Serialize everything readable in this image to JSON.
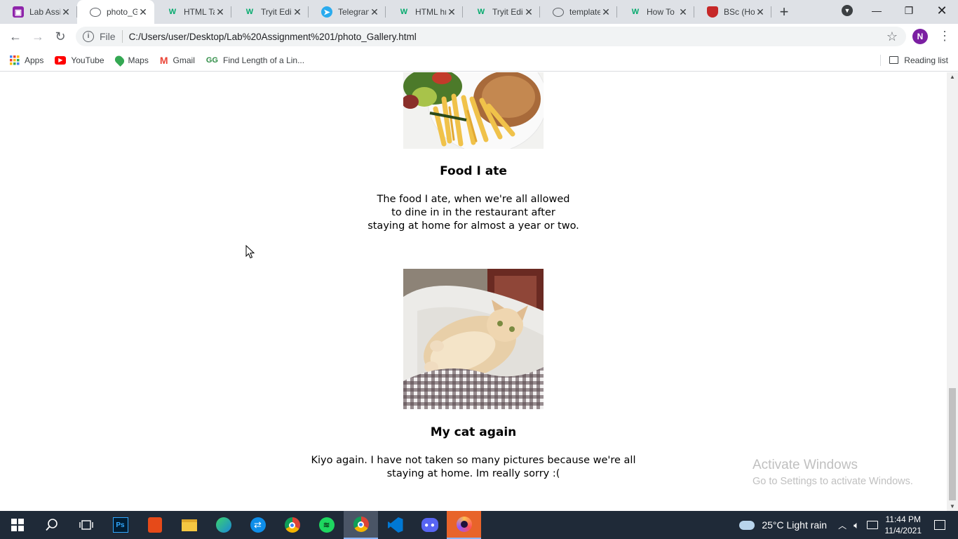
{
  "browser": {
    "tabs": [
      {
        "title": "Lab Assi",
        "icon": "purple-square-icon",
        "active": false
      },
      {
        "title": "photo_G",
        "icon": "globe-icon",
        "active": true
      },
      {
        "title": "HTML Ta",
        "icon": "w3schools-icon",
        "active": false
      },
      {
        "title": "Tryit Edi",
        "icon": "w3schools-icon",
        "active": false
      },
      {
        "title": "Telegran",
        "icon": "telegram-icon",
        "active": false
      },
      {
        "title": "HTML hr",
        "icon": "w3schools-icon",
        "active": false
      },
      {
        "title": "Tryit Edi",
        "icon": "w3schools-icon",
        "active": false
      },
      {
        "title": "template",
        "icon": "globe-icon",
        "active": false
      },
      {
        "title": "How To",
        "icon": "w3schools-icon",
        "active": false
      },
      {
        "title": "BSc (Hon",
        "icon": "crest-icon",
        "active": false
      }
    ],
    "new_tab_label": "+",
    "address": {
      "scheme_label": "File",
      "url": "C:/Users/user/Desktop/Lab%20Assignment%201/photo_Gallery.html"
    },
    "profile_initial": "N",
    "bookmarks": [
      {
        "label": "Apps",
        "icon": "apps-grid-icon"
      },
      {
        "label": "YouTube",
        "icon": "youtube-icon"
      },
      {
        "label": "Maps",
        "icon": "maps-pin-icon"
      },
      {
        "label": "Gmail",
        "icon": "gmail-icon"
      },
      {
        "label": "Find Length of a Lin...",
        "icon": "geeks-icon"
      }
    ],
    "reading_list": "Reading list"
  },
  "page": {
    "gallery": [
      {
        "title": "Food I ate",
        "lines": [
          "The food I ate, when we're all allowed",
          "to dine in in the restaurant after",
          "staying at home for almost a year or two."
        ]
      },
      {
        "title": "My cat again",
        "lines": [
          "Kiyo again. I have not taken so many pictures because we're all",
          "staying at home. Im really sorry :("
        ]
      }
    ]
  },
  "watermark": {
    "line1": "Activate Windows",
    "line2": "Go to Settings to activate Windows."
  },
  "taskbar": {
    "weather": "25°C  Light rain",
    "time": "11:44 PM",
    "date": "11/4/2021"
  },
  "colors": {
    "tab_bg": "#dee1e6",
    "taskbar": "#1f2a38",
    "profile": "#7b1fa2"
  }
}
